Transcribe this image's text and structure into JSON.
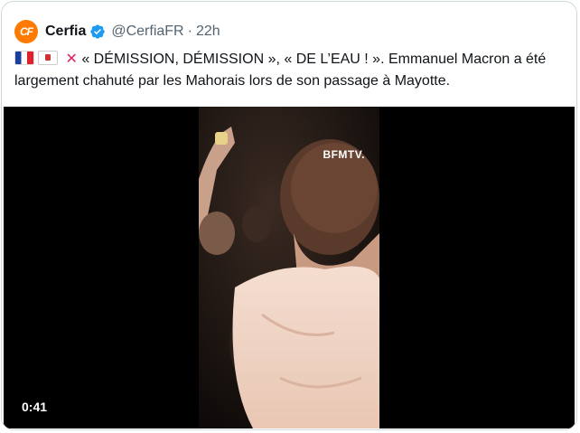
{
  "tweet": {
    "author_name": "Cerfia",
    "avatar_text": "CF",
    "handle": "@CerfiaFR",
    "separator": "·",
    "time": "22h",
    "text_line1": "« DÉMISSION, DÉMISSION », « DE L’EAU ! ». Emmanuel Macron a été",
    "text_line2": "largement chahuté par les Mahorais lors de son passage à Mayotte.",
    "icons": [
      "flag-france-icon",
      "flag-mayotte-icon",
      "cross-mark-icon"
    ]
  },
  "media": {
    "watermark": "BFMTV.",
    "duration": "0:41"
  },
  "colors": {
    "accent": "#1d9bf0",
    "brand_avatar": "#ff7a00",
    "text": "#0f1419",
    "muted": "#536471"
  }
}
